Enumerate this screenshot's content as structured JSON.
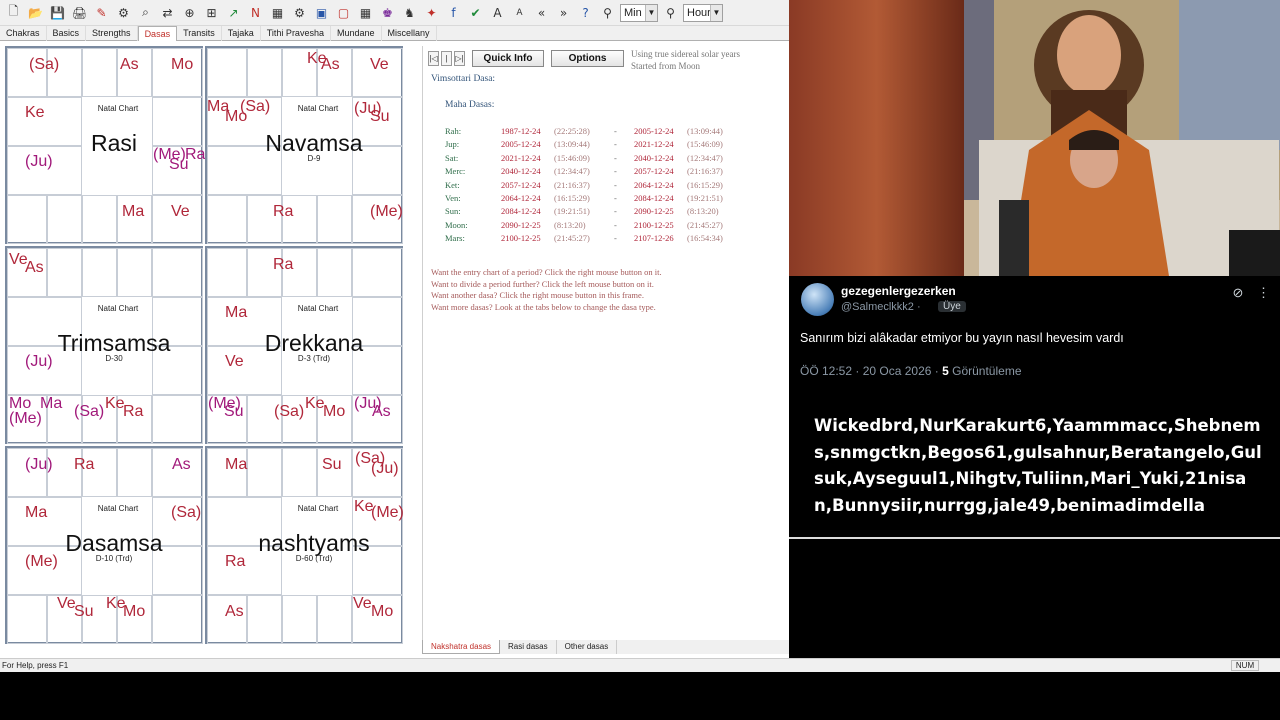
{
  "toolbar": {
    "icons": [
      "new-icon",
      "open-icon",
      "save-icon",
      "print-icon",
      "edit-chart-icon",
      "search-icon",
      "zoom-icon",
      "compare-icon",
      "ruler-icon",
      "sp-icon",
      "plot-icon",
      "n-icon",
      "grid-icon",
      "settings-icon",
      "sb-icon",
      "frame-icon",
      "table-icon",
      "family-icon",
      "game-icon",
      "dasha-icon",
      "facebook-icon",
      "twitter-icon",
      "font-larger-icon",
      "font-smaller-icon",
      "back-icon",
      "forward-icon",
      "help-icon",
      "time-icon"
    ],
    "min_label": "Min",
    "hour_label": "Hour"
  },
  "tabs": [
    "Chakras",
    "Basics",
    "Strengths",
    "Dasas",
    "Transits",
    "Tajaka",
    "Tithi Pravesha",
    "Mundane",
    "Miscellany"
  ],
  "active_tab": "Dasas",
  "charts": [
    {
      "id": "rasi",
      "natal": "Natal Chart",
      "title": "Rasi",
      "sub": ""
    },
    {
      "id": "navamsa",
      "natal": "Natal Chart",
      "title": "Navamsa",
      "sub": "D-9"
    },
    {
      "id": "trimsamsa",
      "natal": "Natal Chart",
      "title": "Trimsamsa",
      "sub": "D-30"
    },
    {
      "id": "drekkana",
      "natal": "Natal Chart",
      "title": "Drekkana",
      "sub": "D-3 (Trd)"
    },
    {
      "id": "dasamsa",
      "natal": "Natal Chart",
      "title": "Dasamsa",
      "sub": "D-10 (Trd)"
    },
    {
      "id": "shashtyamsa",
      "natal": "Natal Chart",
      "title": "nashtyams",
      "sub": "D-60 (Trd)"
    }
  ],
  "dasa": {
    "quick_info": "Quick Info",
    "options": "Options",
    "note1": "Using true sidereal solar years",
    "note2": "Started from Moon",
    "system": "Vimsottari Dasa:",
    "heading": "Maha Dasas:",
    "rows": [
      {
        "planet": "Rah:",
        "d1": "1987-12-24",
        "t1": "(22:25:28)",
        "d2": "2005-12-24",
        "t2": "(13:09:44)"
      },
      {
        "planet": "Jup:",
        "d1": "2005-12-24",
        "t1": "(13:09:44)",
        "d2": "2021-12-24",
        "t2": "(15:46:09)"
      },
      {
        "planet": "Sat:",
        "d1": "2021-12-24",
        "t1": "(15:46:09)",
        "d2": "2040-12-24",
        "t2": "(12:34:47)"
      },
      {
        "planet": "Merc:",
        "d1": "2040-12-24",
        "t1": "(12:34:47)",
        "d2": "2057-12-24",
        "t2": "(21:16:37)"
      },
      {
        "planet": "Ket:",
        "d1": "2057-12-24",
        "t1": "(21:16:37)",
        "d2": "2064-12-24",
        "t2": "(16:15:29)"
      },
      {
        "planet": "Ven:",
        "d1": "2064-12-24",
        "t1": "(16:15:29)",
        "d2": "2084-12-24",
        "t2": "(19:21:51)"
      },
      {
        "planet": "Sun:",
        "d1": "2084-12-24",
        "t1": "(19:21:51)",
        "d2": "2090-12-25",
        "t2": "(8:13:20)"
      },
      {
        "planet": "Moon:",
        "d1": "2090-12-25",
        "t1": "(8:13:20)",
        "d2": "2100-12-25",
        "t2": "(21:45:27)"
      },
      {
        "planet": "Mars:",
        "d1": "2100-12-25",
        "t1": "(21:45:27)",
        "d2": "2107-12-26",
        "t2": "(16:54:34)"
      }
    ],
    "hints": [
      "Want the entry chart of a period? Click the right mouse button on it.",
      "Want to divide a period further? Click the left mouse button on it.",
      "Want another dasa? Click the right mouse button in this frame.",
      "Want more dasas? Look at the tabs below to change the dasa type."
    ]
  },
  "bottom_tabs": [
    "Nakshatra dasas",
    "Rasi dasas",
    "Other dasas"
  ],
  "status": {
    "help": "For Help, press F1",
    "num": "NUM"
  },
  "tweet": {
    "name": "gezegenlergezerken",
    "handle": "@Salmeclkkk2 ·",
    "badge": "Üye",
    "text": "Sanırım bizi alâkadar etmiyor bu yayın nasıl hevesim vardı",
    "time": "ÖÖ 12:52 · 20 Oca 2026 ·",
    "views_count": "5",
    "views_label": "Görüntüleme"
  },
  "names_text": "Wickedbrd,NurKarakurt6,Yaammmacc,Shebnems,snmgctkn,Begos61,gulsahnur,Beratangelo,Gulsuk,Ayseguul1,Nihgtv,Tuliinn,Mari_Yuki,21nisan,Bunnysiir,nurrgg,jale49,benimadimdella",
  "colors": {
    "accent_red": "#b0273a",
    "tab_active": "#c0302a",
    "planet_green": "#2f6d4a"
  }
}
